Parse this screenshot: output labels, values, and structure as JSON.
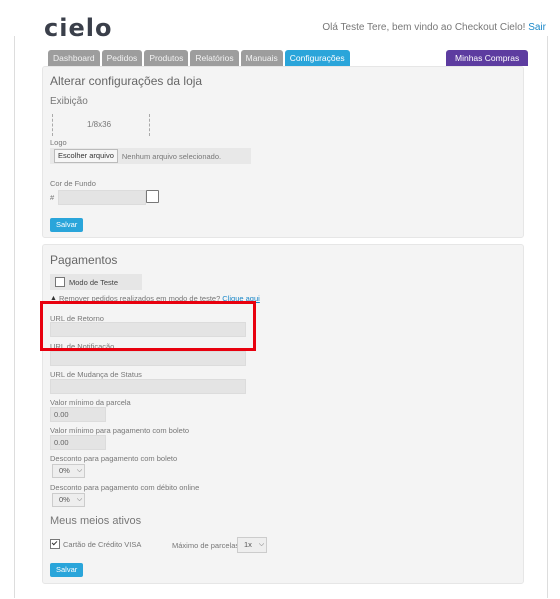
{
  "header": {
    "logo_text": "cielo",
    "greeting": "Olá Teste Tere, bem vindo ao Checkout Cielo!",
    "logout_link": "Sair"
  },
  "tabs": [
    {
      "label": "Dashboard"
    },
    {
      "label": "Pedidos"
    },
    {
      "label": "Produtos"
    },
    {
      "label": "Relatórios"
    },
    {
      "label": "Manuais"
    },
    {
      "label": "Configurações"
    }
  ],
  "active_tab": "Configurações",
  "compras_button": "Minhas Compras",
  "store_settings": {
    "title": "Alterar configurações da loja",
    "section_exibicao": "Exibição",
    "logo_size_text": "1/8x36",
    "logo_label": "Logo",
    "file_button": "Escolher arquivo",
    "file_status": "Nenhum arquivo selecionado.",
    "bgcolor_label": "Cor de Fundo",
    "bgcolor_prefix": "#",
    "bgcolor_value": "",
    "save_button": "Salvar"
  },
  "payments": {
    "title": "Pagamentos",
    "test_mode_label": "Modo de Teste",
    "test_mode_checked": false,
    "remove_text": "Remover pedidos realizados em modo de teste? ",
    "remove_link": "Clique aqui",
    "return_url_label": "URL de Retorno",
    "return_url_value": "",
    "notify_url_label": "URL de Notificação",
    "notify_url_value": "",
    "status_url_label": "URL de Mudança de Status",
    "status_url_value": "",
    "min_parcel_label": "Valor mínimo da parcela",
    "min_parcel_value": "0.00",
    "min_boleto_label": "Valor mínimo para pagamento com boleto",
    "min_boleto_value": "0.00",
    "discount_boleto_label": "Desconto para pagamento com boleto",
    "discount_boleto_value": "0%",
    "discount_online_label": "Desconto para pagamento com débito online",
    "discount_online_value": "0%",
    "methods_title": "Meus meios ativos",
    "visa_label": "Cartão de Crédito VISA",
    "visa_checked": true,
    "max_parcels_label": "Máximo de parcelas",
    "max_parcels_value": "1x",
    "save_button": "Salvar"
  },
  "colors": {
    "accent": "#2aa5da",
    "compras": "#5d3ca0",
    "highlight": "#e8000e"
  }
}
